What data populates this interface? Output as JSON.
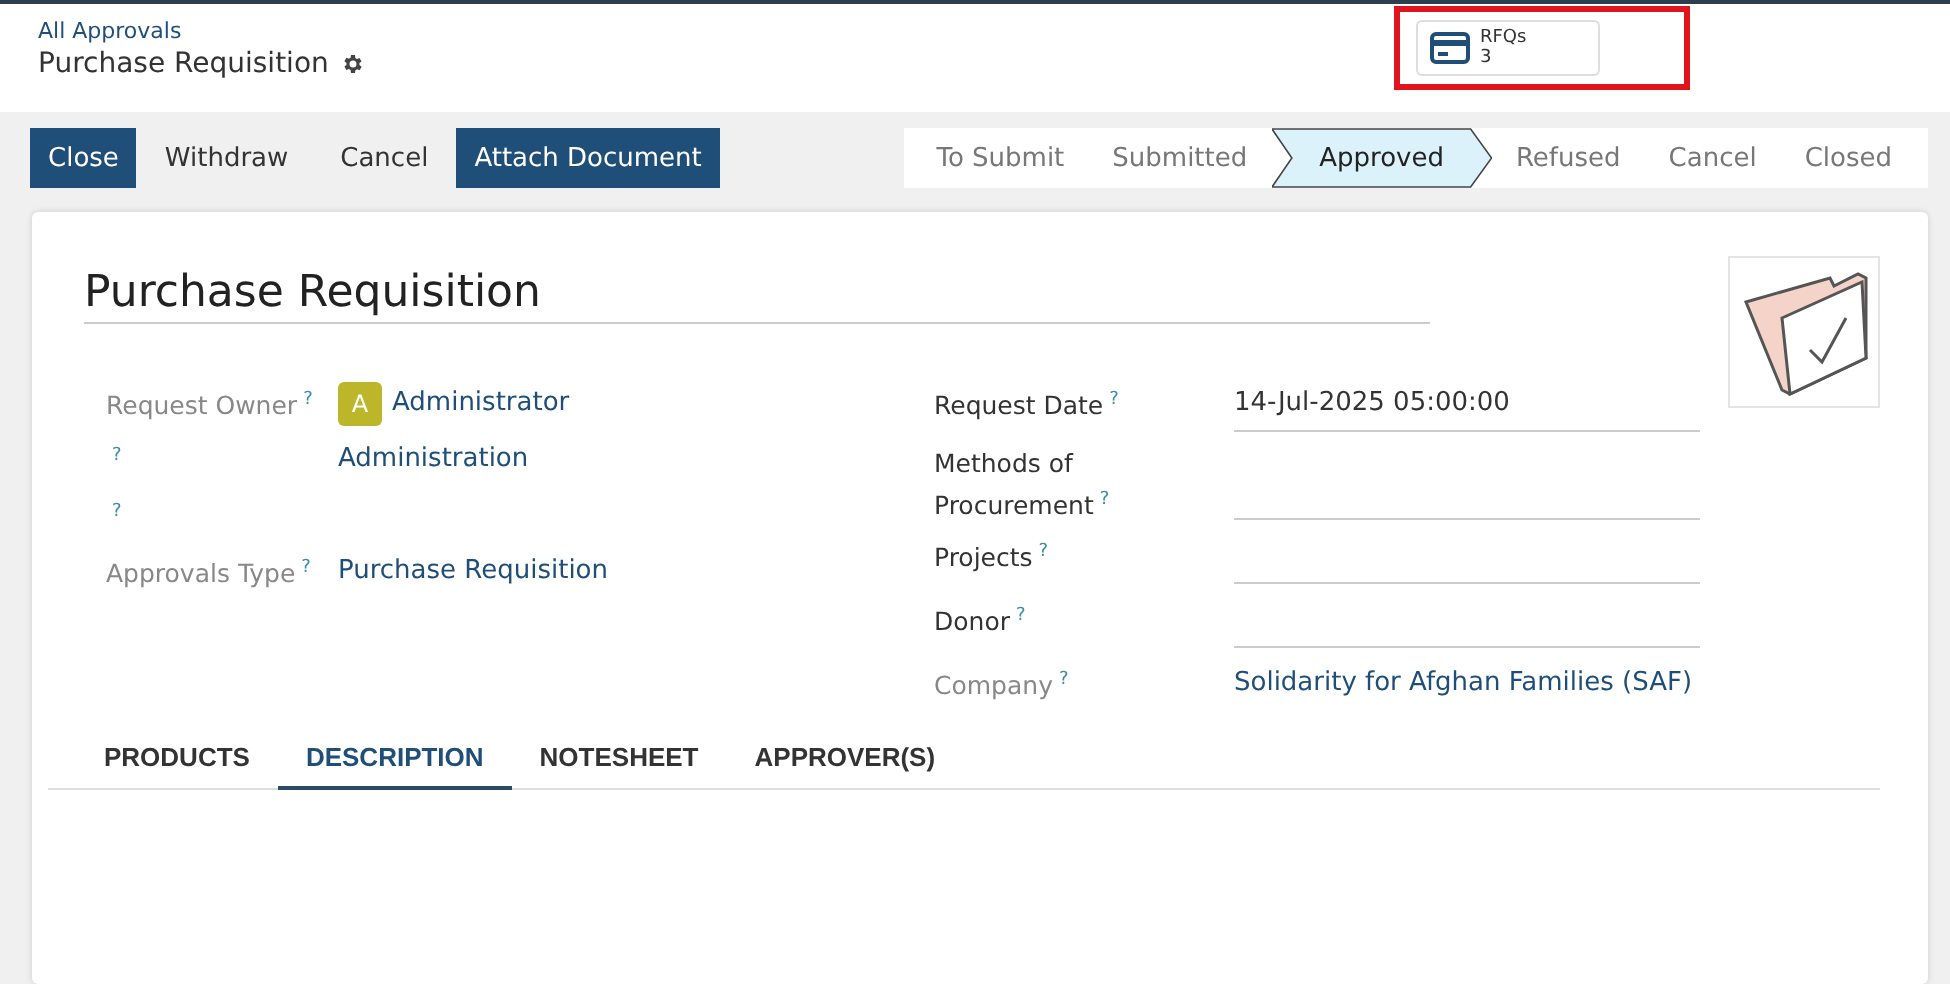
{
  "breadcrumb": {
    "parent": "All Approvals",
    "title": "Purchase Requisition"
  },
  "smart_button": {
    "label": "RFQs",
    "count": "3",
    "highlighted": true
  },
  "actions": [
    {
      "label": "Close",
      "primary": true
    },
    {
      "label": "Withdraw",
      "primary": false
    },
    {
      "label": "Cancel",
      "primary": false
    },
    {
      "label": "Attach Document",
      "primary": true
    }
  ],
  "stages": [
    {
      "label": "To Submit",
      "selected": false
    },
    {
      "label": "Submitted",
      "selected": false
    },
    {
      "label": "Approved",
      "selected": true
    },
    {
      "label": "Refused",
      "selected": false
    },
    {
      "label": "Cancel",
      "selected": false
    },
    {
      "label": "Closed",
      "selected": false
    }
  ],
  "form": {
    "title": "Purchase Requisition",
    "left_fields": [
      {
        "label": "Request Owner",
        "help": "?",
        "readonly": true,
        "avatar": "A",
        "value": "Administrator"
      },
      {
        "help": "?",
        "readonly": true,
        "value": "Administration"
      },
      {
        "help": "?",
        "readonly": true
      },
      {
        "label": "Approvals Type",
        "help": "?",
        "readonly": true,
        "value": "Purchase Requisition"
      }
    ],
    "right_fields": [
      {
        "label": "Request Date",
        "help": "?",
        "readonly": false,
        "value": "14-Jul-2025 05:00:00"
      },
      {
        "label": "Methods of Procurement",
        "help": "?",
        "readonly": false
      },
      {
        "label": "Projects",
        "help": "?",
        "readonly": false
      },
      {
        "label": "Donor",
        "help": "?",
        "readonly": false
      },
      {
        "label": "Company",
        "help": "?",
        "readonly": true,
        "value": "Solidarity for Afghan Families (SAF)"
      }
    ]
  },
  "tabs": [
    {
      "label": "PRODUCTS",
      "selected": false
    },
    {
      "label": "DESCRIPTION",
      "selected": true
    },
    {
      "label": "NOTESHEET",
      "selected": false
    },
    {
      "label": "APPROVER(S)",
      "selected": false
    }
  ]
}
